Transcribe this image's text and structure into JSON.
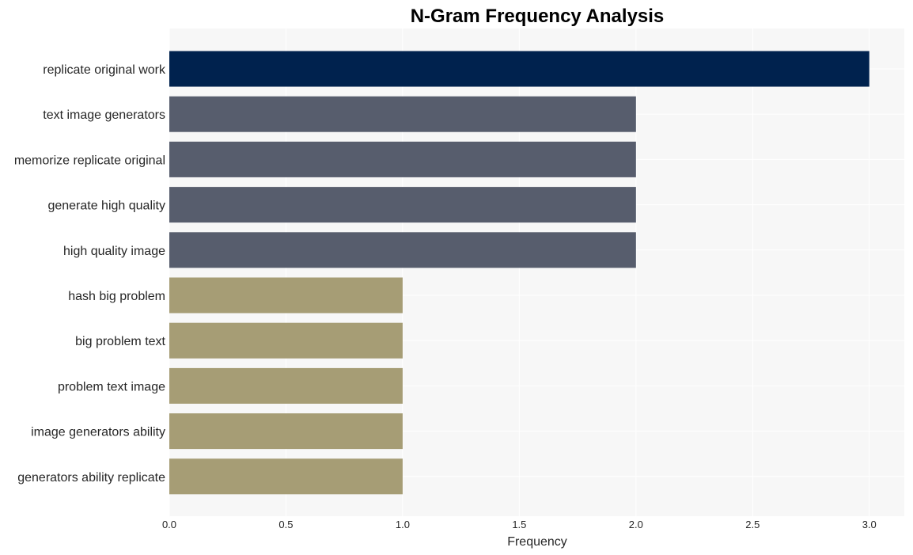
{
  "chart_data": {
    "type": "bar",
    "orientation": "horizontal",
    "title": "N-Gram Frequency Analysis",
    "xlabel": "Frequency",
    "ylabel": "",
    "xlim": [
      0,
      3.15
    ],
    "xticks": [
      0.0,
      0.5,
      1.0,
      1.5,
      2.0,
      2.5,
      3.0
    ],
    "xtick_labels": [
      "0.0",
      "0.5",
      "1.0",
      "1.5",
      "2.0",
      "2.5",
      "3.0"
    ],
    "grid": true,
    "categories": [
      "replicate original work",
      "text image generators",
      "memorize replicate original",
      "generate high quality",
      "high quality image",
      "hash big problem",
      "big problem text",
      "problem text image",
      "image generators ability",
      "generators ability replicate"
    ],
    "values": [
      3,
      2,
      2,
      2,
      2,
      1,
      1,
      1,
      1,
      1
    ],
    "colors": [
      "#00224e",
      "#575d6d",
      "#575d6d",
      "#575d6d",
      "#575d6d",
      "#a69d75",
      "#a69d75",
      "#a69d75",
      "#a69d75",
      "#a69d75"
    ],
    "background": "#f7f7f7",
    "gridline_color": "#ffffff"
  }
}
